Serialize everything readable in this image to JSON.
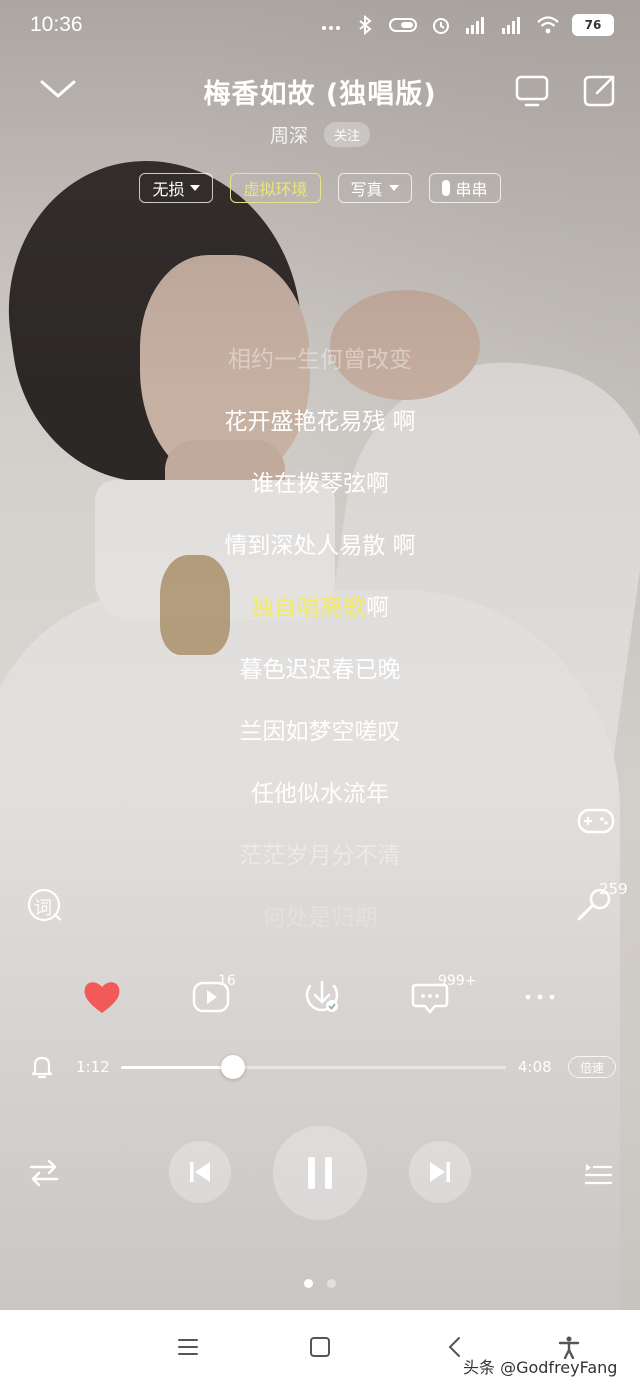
{
  "status_bar": {
    "time": "10:36",
    "battery": "76"
  },
  "header": {
    "title": "梅香如故 (独唱版)",
    "artist": "周深",
    "follow_label": "关注"
  },
  "chips": [
    {
      "label": "无损",
      "dropdown": true
    },
    {
      "label": "虚拟环境",
      "accent": true
    },
    {
      "label": "写真",
      "dropdown": true
    },
    {
      "label": "串串",
      "pill": true
    }
  ],
  "lyrics": {
    "lines": [
      "相约一生何曾改变",
      "花开盛艳花易残 啊",
      "谁在拨琴弦啊",
      "情到深处人易散 啊",
      "独自唱离歌啊",
      "暮色迟迟春已晚",
      "兰因如梦空嗟叹",
      "任他似水流年",
      "茫茫岁月分不清",
      "何处是归期"
    ],
    "current_highlight": "独自唱离歌",
    "current_rest": "啊"
  },
  "side": {
    "lyrics_icon_label": "词",
    "ktv_count": "259"
  },
  "actions": {
    "comments_badge": "16",
    "share_badge": "999+"
  },
  "player": {
    "current_time": "1:12",
    "total_time": "4:08",
    "progress": 0.29,
    "speed_label": "倍速"
  },
  "watermark": "头条 @GodfreyFang",
  "colors": {
    "highlight": "#f3ea66",
    "like": "#f25a5a",
    "accent_chip": "#ede47a"
  }
}
